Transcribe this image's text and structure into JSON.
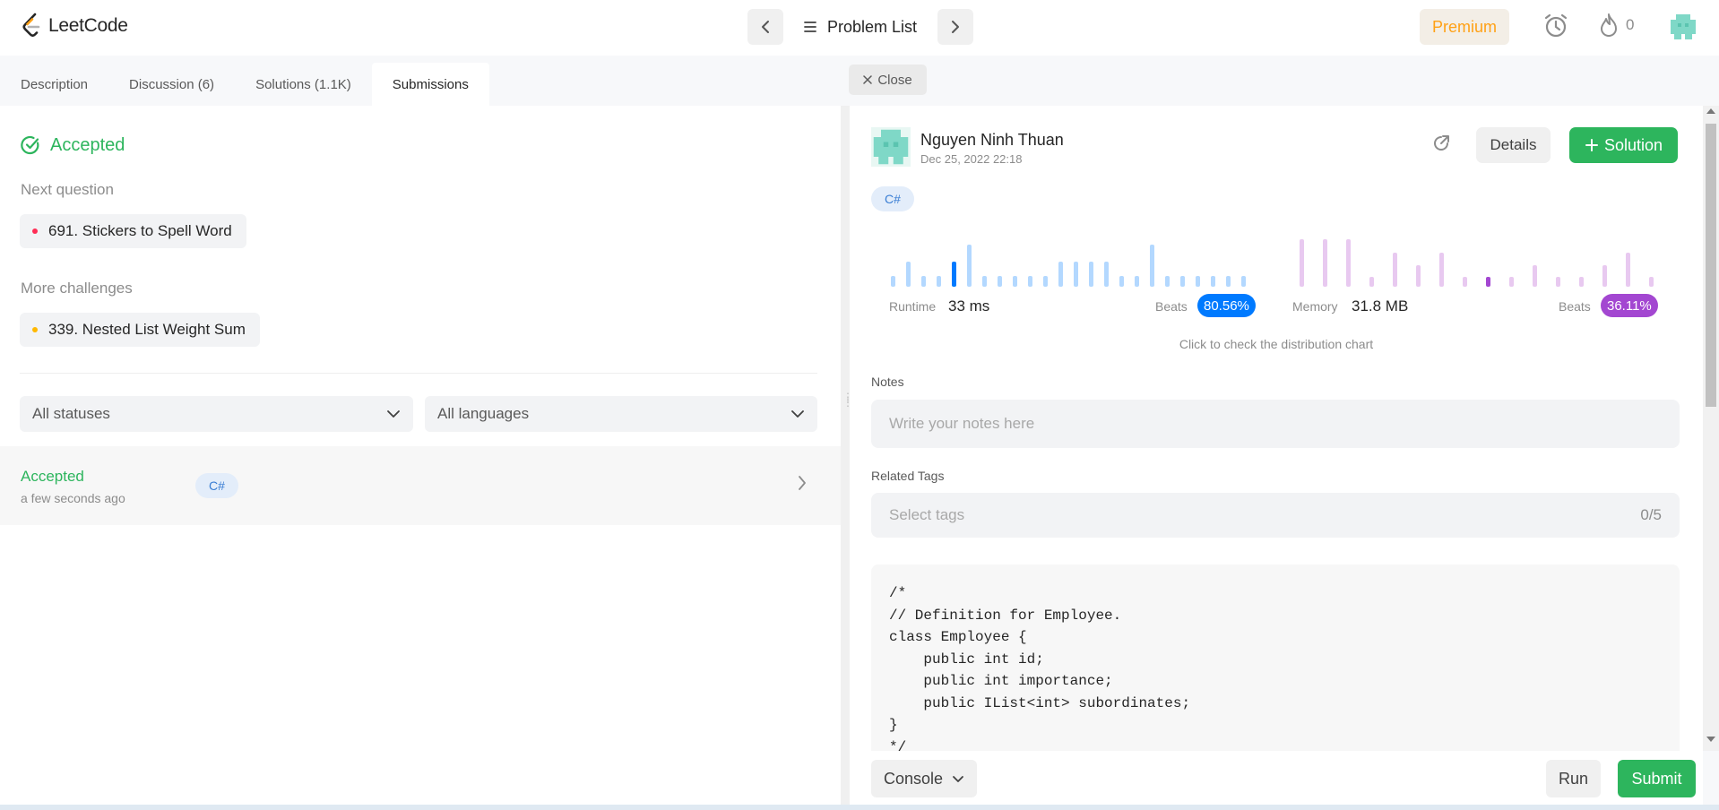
{
  "app": {
    "logo_text": "LeetCode"
  },
  "nav": {
    "problem_list_label": "Problem List",
    "premium_label": "Premium",
    "streak_count": "0"
  },
  "tabs": [
    {
      "label": "Description",
      "active": false
    },
    {
      "label": "Discussion (6)",
      "active": false
    },
    {
      "label": "Solutions (1.1K)",
      "active": false
    },
    {
      "label": "Submissions",
      "active": true
    }
  ],
  "result": {
    "status": "Accepted",
    "next_question_label": "Next question",
    "next_question": {
      "title": "691. Stickers to Spell Word",
      "dot_color": "#ff2d55"
    },
    "more_challenges_label": "More challenges",
    "more_challenge": {
      "title": "339. Nested List Weight Sum",
      "dot_color": "#ffb800"
    }
  },
  "filters": {
    "status_value": "All statuses",
    "language_value": "All languages"
  },
  "submissions": [
    {
      "status": "Accepted",
      "time": "a few seconds ago",
      "language": "C#"
    }
  ],
  "close_label": "Close",
  "detail": {
    "author": "Nguyen Ninh Thuan",
    "date": "Dec 25, 2022 22:18",
    "details_label": "Details",
    "solution_label": "Solution",
    "language": "C#",
    "runtime": {
      "label": "Runtime",
      "value": "33 ms",
      "beats_label": "Beats",
      "beats_value": "80.56%",
      "color": "#007aff",
      "distribution": [
        0.2,
        0.45,
        0.2,
        0.2,
        0.45,
        0.75,
        0.2,
        0.2,
        0.2,
        0.2,
        0.2,
        0.45,
        0.45,
        0.45,
        0.45,
        0.2,
        0.2,
        0.75,
        0.2,
        0.2,
        0.2,
        0.2,
        0.2,
        0.2
      ],
      "highlight_index": 4
    },
    "memory": {
      "label": "Memory",
      "value": "31.8 MB",
      "beats_label": "Beats",
      "beats_value": "36.11%",
      "color": "#a347d1",
      "distribution": [
        0.85,
        0.85,
        0.85,
        0.18,
        0.62,
        0.38,
        0.62,
        0.18,
        0.18,
        0.18,
        0.38,
        0.18,
        0.18,
        0.38,
        0.62,
        0.18
      ],
      "highlight_index": 8
    },
    "dist_hint": "Click to check the distribution chart",
    "notes_label": "Notes",
    "notes_placeholder": "Write your notes here",
    "tags_label": "Related Tags",
    "tags_placeholder": "Select tags",
    "tags_count": "0/5",
    "code_lines": [
      "/*",
      "// Definition for Employee.",
      "class Employee {",
      "    public int id;",
      "    public int importance;",
      "    public IList<int> subordinates;",
      "}",
      "*/"
    ]
  },
  "bottom": {
    "console_label": "Console",
    "run_label": "Run",
    "submit_label": "Submit"
  },
  "colors": {
    "green": "#2db55d",
    "premium": "#ffa116",
    "blue_light": "#b3d8ff",
    "purple_light": "#e8c9f0"
  }
}
